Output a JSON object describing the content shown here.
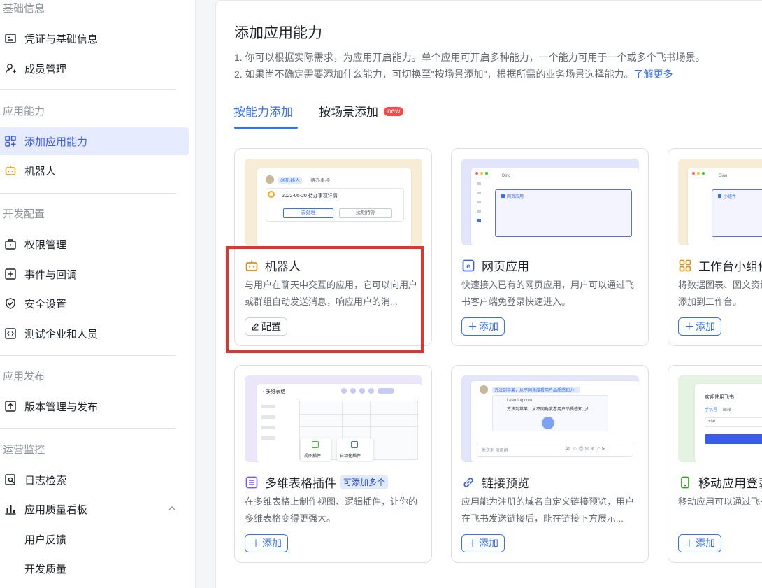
{
  "sidebar": {
    "sections": [
      {
        "title": "基础信息",
        "items": [
          {
            "label": "凭证与基础信息",
            "icon": "id-card-icon"
          },
          {
            "label": "成员管理",
            "icon": "user-add-icon"
          }
        ]
      },
      {
        "title": "应用能力",
        "items": [
          {
            "label": "添加应用能力",
            "icon": "grid-add-icon",
            "active": true
          },
          {
            "label": "机器人",
            "icon": "robot-icon"
          }
        ]
      },
      {
        "title": "开发配置",
        "items": [
          {
            "label": "权限管理",
            "icon": "briefcase-icon"
          },
          {
            "label": "事件与回调",
            "icon": "event-icon"
          },
          {
            "label": "安全设置",
            "icon": "shield-icon"
          },
          {
            "label": "测试企业和人员",
            "icon": "code-icon"
          }
        ]
      },
      {
        "title": "应用发布",
        "items": [
          {
            "label": "版本管理与发布",
            "icon": "upload-icon"
          }
        ]
      },
      {
        "title": "运营监控",
        "items": [
          {
            "label": "日志检索",
            "icon": "log-search-icon"
          },
          {
            "label": "应用质量看板",
            "icon": "bar-chart-icon",
            "expanded": true
          },
          {
            "label": "用户反馈"
          },
          {
            "label": "开发质量"
          }
        ]
      }
    ]
  },
  "main": {
    "title": "添加应用能力",
    "desc1": "1. 你可以根据实际需求，为应用开启能力。单个应用可开启多种能力，一个能力可用于一个或多个飞书场景。",
    "desc2": "2. 如果尚不确定需要添加什么能力，可切换至\"按场景添加\"，根据所需的业务场景选择能力。",
    "learn_more": "了解更多",
    "tabs": [
      {
        "label": "按能力添加",
        "active": true
      },
      {
        "label": "按场景添加",
        "badge": "new"
      }
    ],
    "cards": [
      {
        "title": "机器人",
        "icon": "robot-icon",
        "desc": "与用户在聊天中交互的应用，它可以向用户或群组自动发送消息，响应用户的消...",
        "button": "配置",
        "button_icon": "edit-icon",
        "preview": {
          "bg": "#f7ecd5",
          "tag": "@机器人",
          "todo": "待办事项",
          "date_line": "2022-05-20 待办事项详情",
          "b1": "去处理",
          "b2": "延期待办"
        }
      },
      {
        "title": "网页应用",
        "icon": "web-app-icon",
        "desc": "快速接入已有的网页应用，用户可以通过飞书客户端免登录快速进入。",
        "button": "添加",
        "button_icon": "plus-icon",
        "preview": {
          "bg": "#e3e6fb",
          "tab": "Dino",
          "label": "网页应用"
        }
      },
      {
        "title": "工作台小组件",
        "icon": "widget-icon",
        "desc": "将数据图表、图文资讯等内容以小组件形式添加到工作台。",
        "button": "添加",
        "button_icon": "plus-icon",
        "preview": {
          "bg": "#f7ecd5",
          "tab": "Dino",
          "label": "小组件"
        }
      },
      {
        "title": "多维表格插件",
        "icon": "bitable-icon",
        "badge": "可添加多个",
        "desc": "在多维表格上制作视图、逻辑插件，让你的多维表格变得更强大。",
        "button": "添加",
        "button_icon": "plus-icon",
        "preview": {
          "bg": "#ece6fb",
          "header": "多维表格",
          "p1": "视图插件",
          "p2": "自动化插件"
        }
      },
      {
        "title": "链接预览",
        "icon": "link-icon",
        "desc": "应用能为注册的域名自定义链接预览，用户在飞书发送链接后，能在链接下方展示...",
        "button": "添加",
        "button_icon": "plus-icon",
        "preview": {
          "bg": "#e3e6fb",
          "msg": "方法到苹果，从不同角度看用户品质感知力！",
          "site": "Learning.com",
          "site_desc": "方法到苹果，从不同角度看用户品质感知力！",
          "input": "发送到 项目组"
        }
      },
      {
        "title": "移动应用登录",
        "icon": "mobile-icon",
        "desc": "移动应用可以通过飞书账号登录。",
        "button": "添加",
        "button_icon": "plus-icon",
        "preview": {
          "bg": "#e5f3e2",
          "welcome": "欢迎使用飞书",
          "t1": "手机号",
          "t2": "邮箱",
          "code": "+86"
        }
      }
    ]
  },
  "colors": {
    "accent": "#3370ff",
    "active_bg": "#e6ebfe",
    "highlight": "#e5322d",
    "badge": "#f54a45"
  }
}
